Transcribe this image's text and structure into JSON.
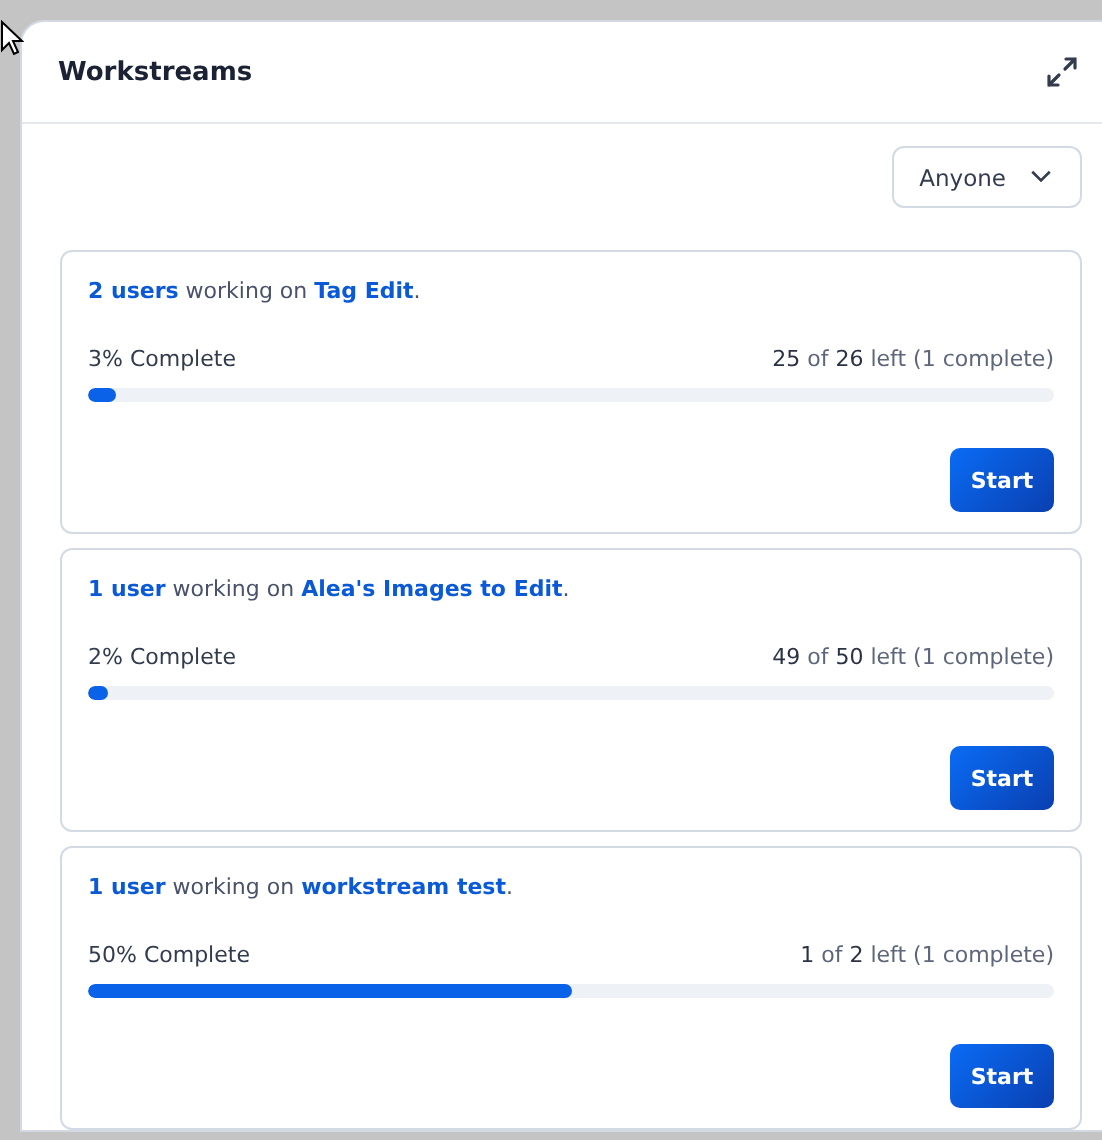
{
  "panel": {
    "title": "Workstreams"
  },
  "filter": {
    "value": "Anyone"
  },
  "workstreams": [
    {
      "users": "2 users",
      "middle": " working on ",
      "project": "Tag Edit",
      "end": ".",
      "progress_label": "3% Complete",
      "remaining": "**25** of **26** left (1 complete)",
      "level": 0.03,
      "button": "Start"
    },
    {
      "users": "1 user",
      "middle": " working on ",
      "project": "Alea's Images to Edit",
      "end": ".",
      "progress_label": "2% Complete",
      "remaining": "**49** of **50** left (1 complete)",
      "level": 0.02,
      "button": "Start"
    },
    {
      "users": "1 user",
      "middle": " working on ",
      "project": "workstream test",
      "end": ".",
      "progress_label": "50% Complete",
      "remaining": "**1** of **2** left (1 complete)",
      "level": 0.5,
      "button": "Start"
    }
  ]
}
